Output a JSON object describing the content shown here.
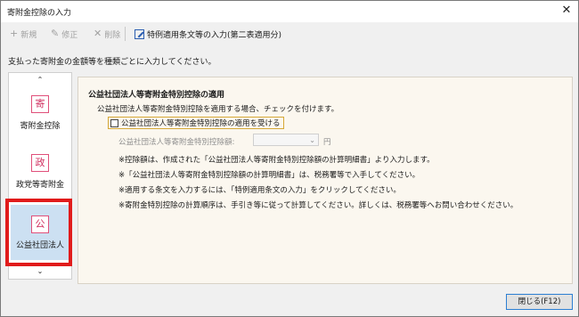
{
  "window": {
    "title": "寄附金控除の入力",
    "close_glyph": "✕"
  },
  "toolbar": {
    "new": {
      "icon": "plus-icon",
      "glyph": "+",
      "label": "新規"
    },
    "edit": {
      "icon": "pencil-icon",
      "glyph": "✎",
      "label": "修正"
    },
    "delete": {
      "icon": "cross-icon",
      "glyph": "✕",
      "label": "削除"
    },
    "special": {
      "icon": "edit-icon",
      "label": "特例適用条文等の入力(第二表適用分)"
    }
  },
  "instruction": "支払った寄附金の金額等を種類ごとに入力してください。",
  "sidebar": {
    "up_arrow": "⌃",
    "down_arrow": "⌄",
    "items": [
      {
        "glyph": "寄",
        "label": "寄附金控除"
      },
      {
        "glyph": "政",
        "label": "政党等寄附金"
      },
      {
        "glyph": "公",
        "label": "公益社団法人"
      }
    ],
    "selected_index": 2
  },
  "panel": {
    "title": "公益社団法人等寄附金特別控除の適用",
    "description": "公益社団法人等寄附金特別控除を適用する場合、チェックを付けます。",
    "checkbox_label": "公益社団法人等寄附金特別控除の適用を受ける",
    "checkbox_checked": false,
    "amount_label": "公益社団法人等寄附金特別控除額:",
    "amount_value": "",
    "dropdown_glyph": "⌄",
    "unit": "円",
    "notes": [
      "※控除額は、作成された「公益社団法人等寄附金特別控除額の計算明細書」より入力します。",
      "※「公益社団法人等寄附金特別控除額の計算明細書」は、税務署等で入手してください。",
      "※適用する条文を入力するには、「特例適用条文の入力」をクリックしてください。",
      "※寄附金特別控除の計算順序は、手引き等に従って計算してください。詳しくは、税務署等へお問い合わせください。"
    ]
  },
  "buttons": {
    "close": "閉じる(F12)"
  },
  "colors": {
    "selection_highlight": "#e11b1b",
    "selected_bg": "#cce0f2",
    "panel_bg": "#fbf7ef",
    "icon_accent": "#e0507a"
  }
}
